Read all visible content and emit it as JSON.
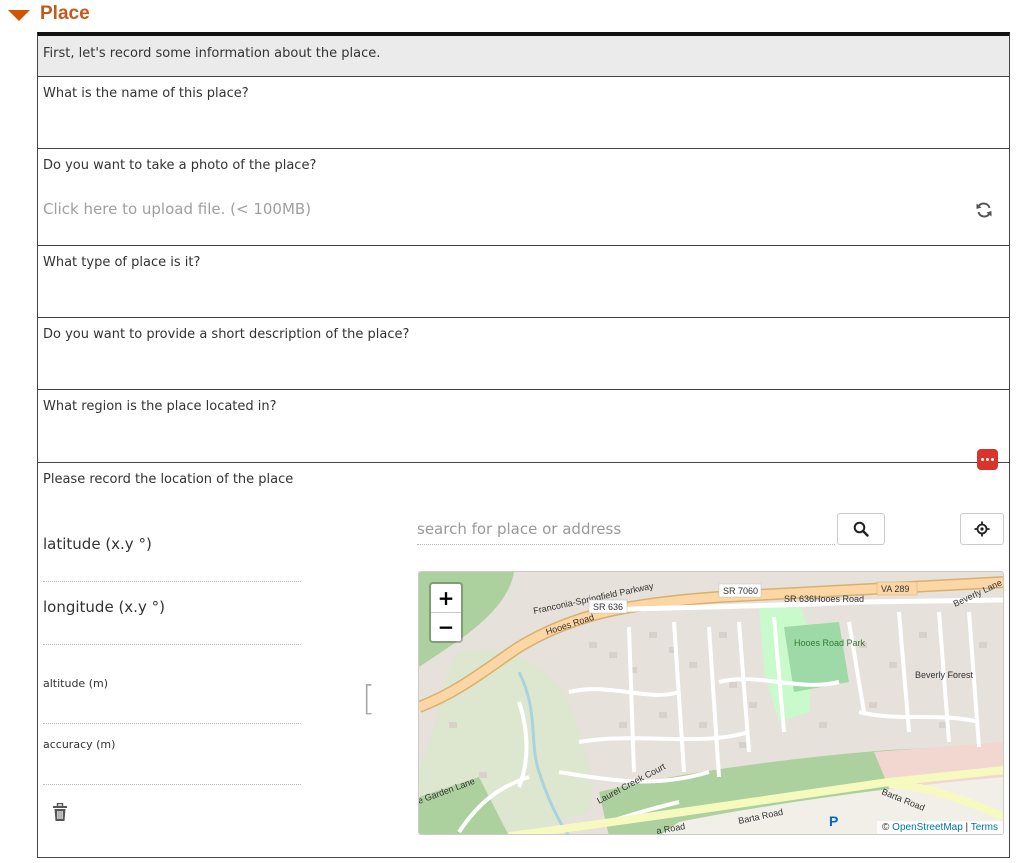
{
  "section": {
    "title": "Place"
  },
  "intro": "First, let's record some information about the place.",
  "questions": {
    "name": "What is the name of this place?",
    "photo": "Do you want to take a photo of the place?",
    "type": "What type of place is it?",
    "description": "Do you want to provide a short description of the place?",
    "region": "What region is the place located in?",
    "location": "Please record the location of the place"
  },
  "photo_upload": "Click here to upload file. (< 100MB)",
  "location": {
    "latitude_label": "latitude (x.y °)",
    "longitude_label": "longitude (x.y °)",
    "altitude_label": "altitude (m)",
    "accuracy_label": "accuracy (m)",
    "bracket": "[",
    "search_placeholder": "search for place or address"
  },
  "map": {
    "zoom_in": "+",
    "zoom_out": "−",
    "attribution_prefix": "© ",
    "attribution_osm": "OpenStreetMap",
    "attribution_sep": " | ",
    "attribution_terms": "Terms",
    "labels": {
      "parkway": "Franconia-Springfield Parkway",
      "sr7060": "SR 7060",
      "sr636a": "SR 636",
      "sr636b": "SR 636",
      "hooes_road_top": "Hooes Road",
      "va289": "VA 289",
      "beverly_lane": "Beverly Lane",
      "hooes_road_left": "Hooes Road",
      "hooes_park": "Hooes Road Park",
      "beverly_forest": "Beverly Forest",
      "barta_road_right": "Barta Road",
      "barta_road_bottom": "Barta Road",
      "a_road": "a Road",
      "garden_lane": "e Garden Lane",
      "laurel_creek": "Laurel Creek Court",
      "parking": "P"
    }
  },
  "colors": {
    "accent": "#c5591a",
    "more_button": "#d9342b"
  },
  "icons": {
    "refresh": "refresh-icon",
    "more": "more-icon",
    "trash": "trash-icon",
    "search": "search-icon",
    "locate": "locate-icon",
    "collapse": "triangle-down-icon"
  }
}
